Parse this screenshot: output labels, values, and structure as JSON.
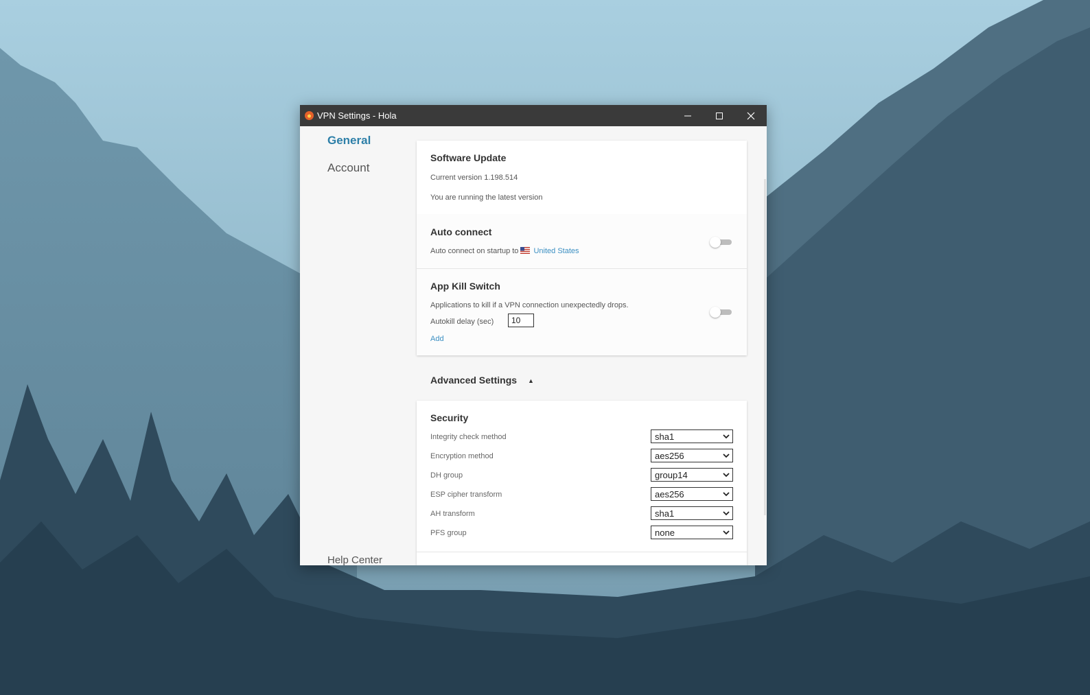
{
  "window": {
    "title": "VPN Settings - Hola"
  },
  "nav": {
    "general": "General",
    "account": "Account",
    "help": "Help Center"
  },
  "software_update": {
    "heading": "Software Update",
    "version": "Current version 1.198.514",
    "status": "You are running the latest version"
  },
  "auto_connect": {
    "heading": "Auto connect",
    "text": "Auto connect on startup to",
    "country": "United States",
    "enabled": false
  },
  "kill_switch": {
    "heading": "App Kill Switch",
    "description": "Applications to kill if a VPN connection unexpectedly drops.",
    "delay_label": "Autokill delay (sec)",
    "delay_value": "10",
    "add_label": "Add",
    "enabled": false
  },
  "advanced": {
    "label": "Advanced Settings",
    "caret": "▲"
  },
  "security": {
    "heading": "Security",
    "rows": [
      {
        "label": "Integrity check method",
        "value": "sha1"
      },
      {
        "label": "Encryption method",
        "value": "aes256"
      },
      {
        "label": "DH group",
        "value": "group14"
      },
      {
        "label": "ESP cipher transform",
        "value": "aes256"
      },
      {
        "label": "AH transform",
        "value": "sha1"
      },
      {
        "label": "PFS group",
        "value": "none"
      }
    ]
  },
  "colors": {
    "accent": "#2d7fa8",
    "link": "#3b8fc2",
    "titlebar": "#3a3a3a"
  },
  "icons": {
    "app": "hola-icon",
    "flag": "us-flag-icon",
    "minimize": "minimize-icon",
    "maximize": "maximize-icon",
    "close": "close-icon"
  }
}
